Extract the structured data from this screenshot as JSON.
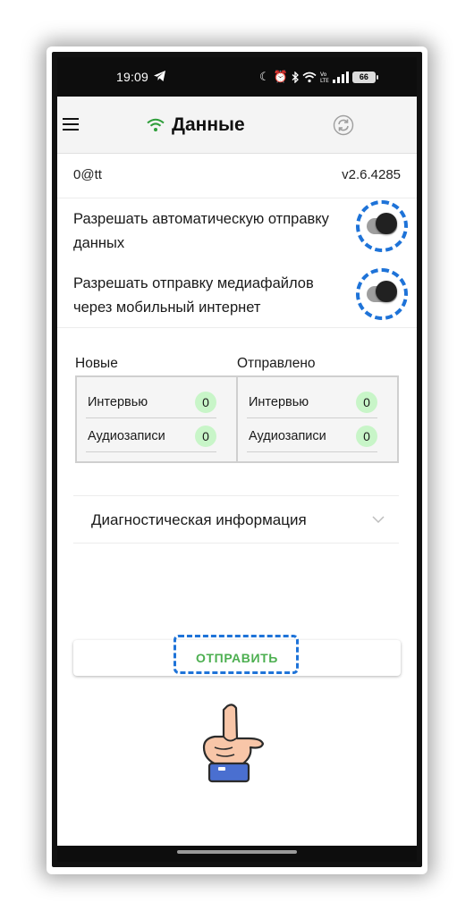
{
  "status_bar": {
    "time": "19:09",
    "battery": "66",
    "icons": [
      "telegram-icon",
      "moon-icon",
      "alarm-icon",
      "bluetooth-icon",
      "wifi-icon",
      "volte-icon",
      "signal-icon",
      "battery-icon"
    ]
  },
  "app_bar": {
    "title": "Данные",
    "wifi_color": "#2e9e3a"
  },
  "info": {
    "user_id": "0@tt",
    "version": "v2.6.4285"
  },
  "settings": {
    "auto_send": {
      "label": "Разрешать автоматическую отправку данных",
      "on": true
    },
    "mobile_media": {
      "label": "Разрешать отправку медиафайлов через мобильный интернет",
      "on": true
    }
  },
  "stats": {
    "new": {
      "header": "Новые",
      "rows": [
        {
          "label": "Интервью",
          "count": "0"
        },
        {
          "label": "Аудиозаписи",
          "count": "0"
        }
      ]
    },
    "sent": {
      "header": "Отправлено",
      "rows": [
        {
          "label": "Интервью",
          "count": "0"
        },
        {
          "label": "Аудиозаписи",
          "count": "0"
        }
      ]
    }
  },
  "diagnostics": {
    "label": "Диагностическая информация"
  },
  "send_button": {
    "label": "ОТПРАВИТЬ"
  },
  "colors": {
    "accent_green": "#4caf50",
    "highlight_blue": "#1e73d8",
    "badge_green": "#c8f5c8"
  }
}
